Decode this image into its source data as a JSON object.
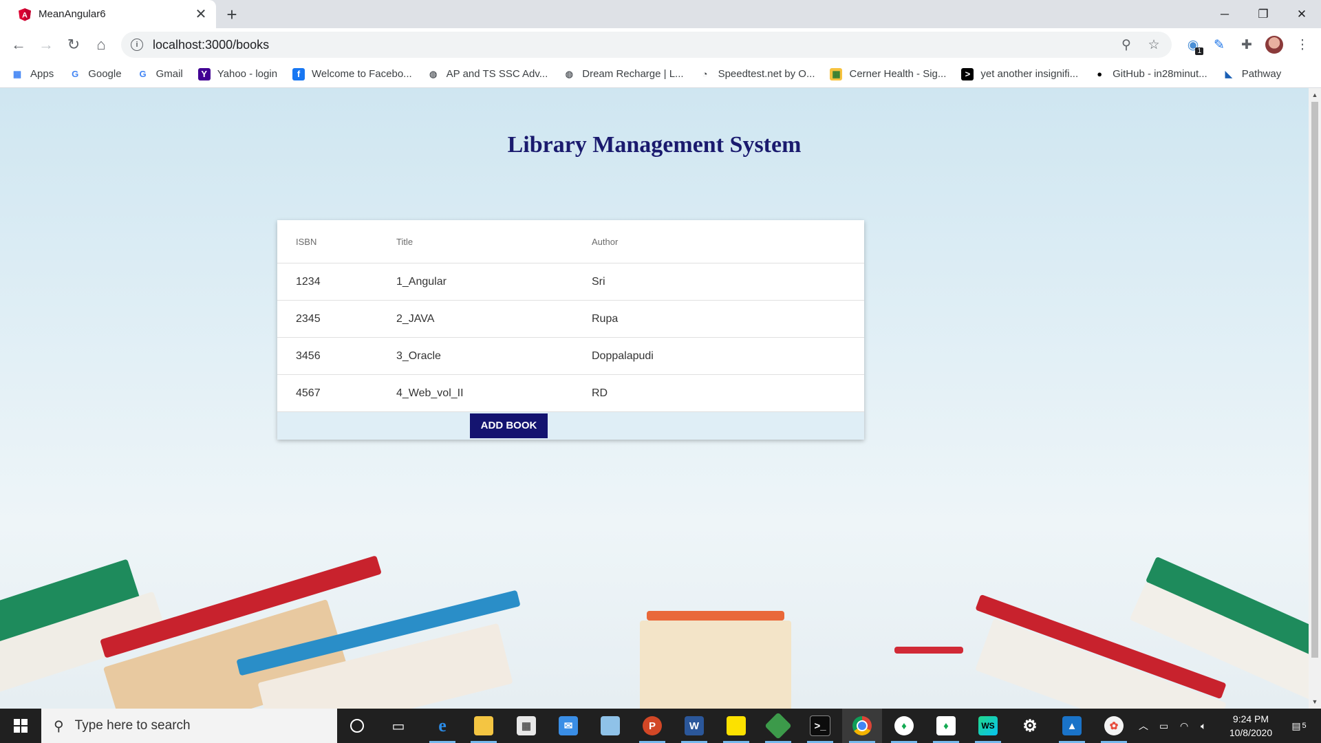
{
  "browser": {
    "tab_title": "MeanAngular6",
    "url": "localhost:3000/books",
    "bookmarks": [
      {
        "label": "Apps",
        "icon": "apps-grid-icon"
      },
      {
        "label": "Google",
        "icon": "google-icon"
      },
      {
        "label": "Gmail",
        "icon": "google-icon"
      },
      {
        "label": "Yahoo - login",
        "icon": "yahoo-icon"
      },
      {
        "label": "Welcome to Facebo...",
        "icon": "facebook-icon"
      },
      {
        "label": "AP and TS SSC Adv...",
        "icon": "globe-icon"
      },
      {
        "label": "Dream Recharge | L...",
        "icon": "globe-icon"
      },
      {
        "label": "Speedtest.net by O...",
        "icon": "speedtest-icon"
      },
      {
        "label": "Cerner Health - Sig...",
        "icon": "cerner-icon"
      },
      {
        "label": "yet another insignifi...",
        "icon": "terminal-icon"
      },
      {
        "label": "GitHub - in28minut...",
        "icon": "github-icon"
      },
      {
        "label": "Pathway",
        "icon": "pathway-icon"
      }
    ],
    "extension_badge": "1"
  },
  "page": {
    "title": "Library Management System",
    "table": {
      "headers": [
        "ISBN",
        "Title",
        "Author"
      ],
      "rows": [
        [
          "1234",
          "1_Angular",
          "Sri"
        ],
        [
          "2345",
          "2_JAVA",
          "Rupa"
        ],
        [
          "3456",
          "3_Oracle",
          "Doppalapudi"
        ],
        [
          "4567",
          "4_Web_vol_II",
          "RD"
        ]
      ]
    },
    "add_button_label": "ADD BOOK",
    "colors": {
      "title": "#1a1a6e",
      "button": "#141470"
    }
  },
  "taskbar": {
    "search_placeholder": "Type here to search",
    "time": "9:24 PM",
    "date": "10/8/2020",
    "notification_count": "5"
  }
}
